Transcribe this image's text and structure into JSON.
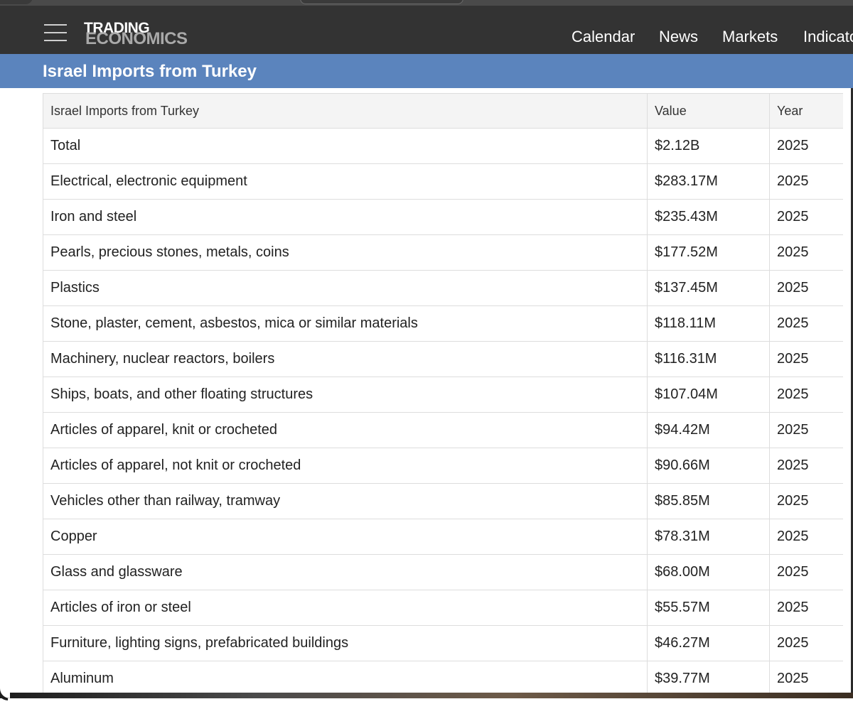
{
  "app": {
    "logo_line1": "TRADING",
    "logo_line2": "ECONOMICS"
  },
  "nav": {
    "items": [
      {
        "label": "Calendar"
      },
      {
        "label": "News"
      },
      {
        "label": "Markets"
      },
      {
        "label": "Indicato"
      }
    ]
  },
  "icons": {
    "menu": "hamburger-menu-icon"
  },
  "page": {
    "title": "Israel Imports from Turkey"
  },
  "table": {
    "headers": [
      "Israel Imports from Turkey",
      "Value",
      "Year"
    ],
    "rows": [
      [
        "Total",
        "$2.12B",
        "2025"
      ],
      [
        "Electrical, electronic equipment",
        "$283.17M",
        "2025"
      ],
      [
        "Iron and steel",
        "$235.43M",
        "2025"
      ],
      [
        "Pearls, precious stones, metals, coins",
        "$177.52M",
        "2025"
      ],
      [
        "Plastics",
        "$137.45M",
        "2025"
      ],
      [
        "Stone, plaster, cement, asbestos, mica or similar materials",
        "$118.11M",
        "2025"
      ],
      [
        "Machinery, nuclear reactors, boilers",
        "$116.31M",
        "2025"
      ],
      [
        "Ships, boats, and other floating structures",
        "$107.04M",
        "2025"
      ],
      [
        "Articles of apparel, knit or crocheted",
        "$94.42M",
        "2025"
      ],
      [
        "Articles of apparel, not knit or crocheted",
        "$90.66M",
        "2025"
      ],
      [
        "Vehicles other than railway, tramway",
        "$85.85M",
        "2025"
      ],
      [
        "Copper",
        "$78.31M",
        "2025"
      ],
      [
        "Glass and glassware",
        "$68.00M",
        "2025"
      ],
      [
        "Articles of iron or steel",
        "$55.57M",
        "2025"
      ],
      [
        "Furniture, lighting signs, prefabricated buildings",
        "$46.27M",
        "2025"
      ],
      [
        "Aluminum",
        "$39.77M",
        "2025"
      ]
    ]
  },
  "colors": {
    "navbar": "#333333",
    "title_bar": "#5b84bd",
    "header_row": "#f4f4f4",
    "border": "#dddddd"
  }
}
